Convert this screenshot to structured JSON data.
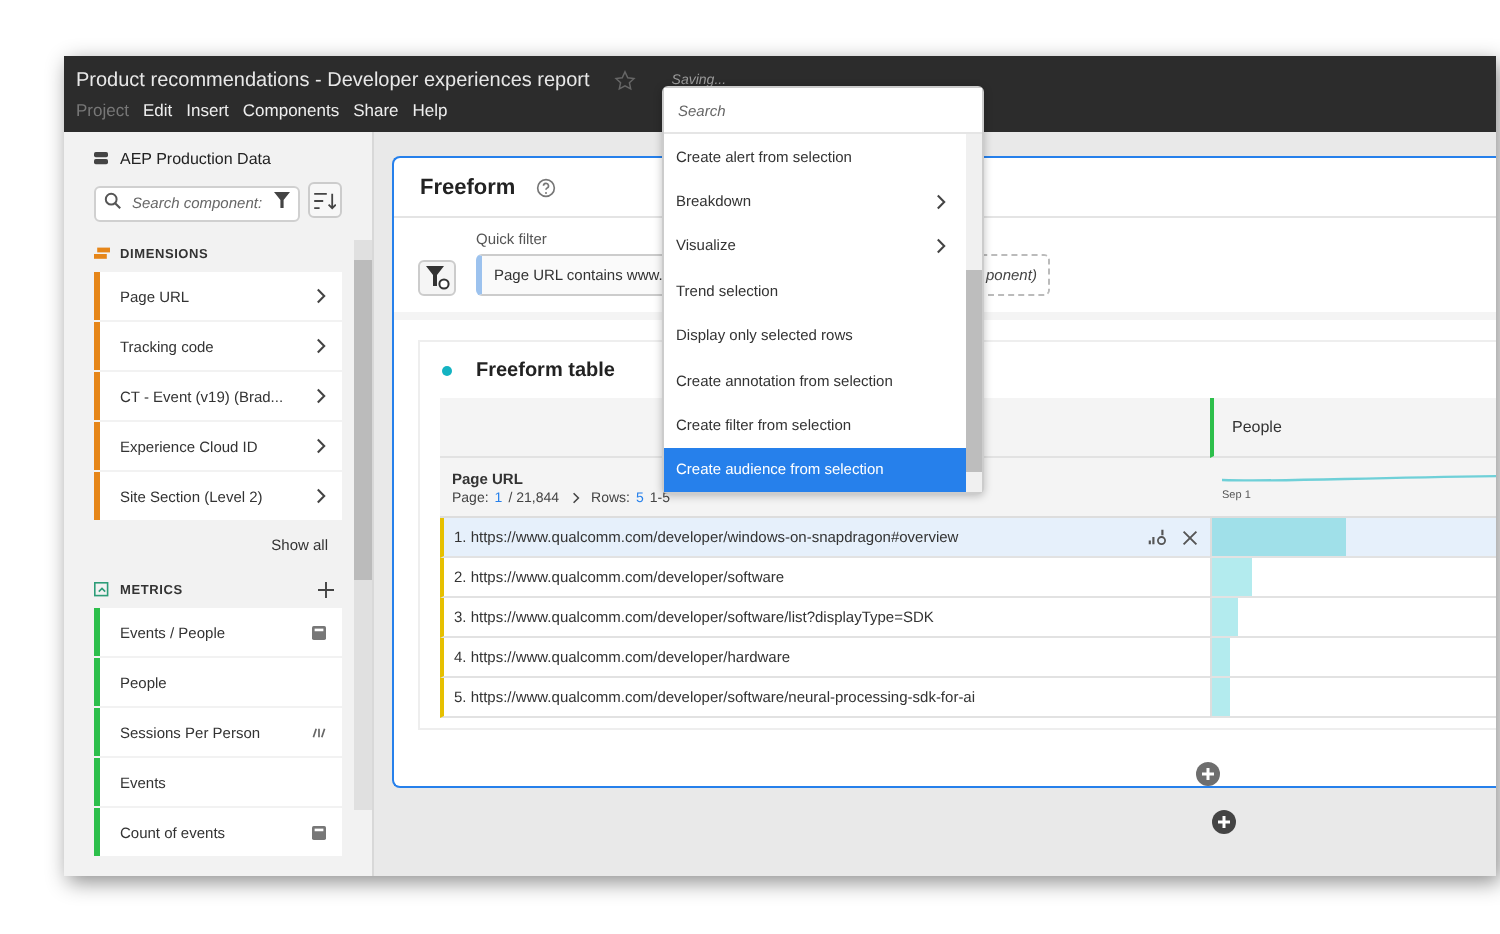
{
  "window": {
    "title": "Product recommendations - Developer experiences report",
    "status": "Saving..."
  },
  "menu_bar": [
    {
      "label": "Project",
      "disabled": true
    },
    {
      "label": "Edit",
      "disabled": false
    },
    {
      "label": "Insert",
      "disabled": false
    },
    {
      "label": "Components",
      "disabled": false
    },
    {
      "label": "Share",
      "disabled": false
    },
    {
      "label": "Help",
      "disabled": false
    }
  ],
  "sidebar": {
    "data_view": "AEP Production Data",
    "search": {
      "placeholder": "Search component:"
    },
    "dimensions": {
      "title": "DIMENSIONS",
      "items": [
        "Page URL",
        "Tracking code",
        "CT - Event (v19) (Brad...",
        "Experience Cloud ID",
        "Site Section (Level 2)"
      ],
      "show_all": "Show all"
    },
    "metrics": {
      "title": "METRICS",
      "items": [
        {
          "label": "Events / People",
          "kind": "calculated"
        },
        {
          "label": "People",
          "kind": "plain"
        },
        {
          "label": "Sessions Per Person",
          "kind": "shared"
        },
        {
          "label": "Events",
          "kind": "plain"
        },
        {
          "label": "Count of events",
          "kind": "calculated"
        }
      ]
    }
  },
  "panel": {
    "title": "Freeform",
    "quick_filter": {
      "label": "Quick filter",
      "value": "Page URL contains www.",
      "value_tail": "ponent)"
    },
    "table": {
      "title": "Freeform table",
      "dimension": "Page URL",
      "pagination": {
        "page_label": "Page:",
        "page": "1",
        "page_total": "/ 21,844",
        "rows_label": "Rows:",
        "rows": "5",
        "range": "1-5"
      },
      "columns": [
        {
          "label": "People",
          "axis_label": "Sep 1"
        }
      ],
      "rows": [
        {
          "label": "1.  https://www.qualcomm.com/developer/windows-on-snapdragon#overview",
          "selected": true,
          "level": 0.46
        },
        {
          "label": "2.  https://www.qualcomm.com/developer/software",
          "selected": false,
          "level": 0.14
        },
        {
          "label": "3.  https://www.qualcomm.com/developer/software/list?displayType=SDK",
          "selected": false,
          "level": 0.09
        },
        {
          "label": "4.  https://www.qualcomm.com/developer/hardware",
          "selected": false,
          "level": 0.06
        },
        {
          "label": "5.  https://www.qualcomm.com/developer/software/neural-processing-sdk-for-ai",
          "selected": false,
          "level": 0.06
        }
      ]
    }
  },
  "context_menu": {
    "search": {
      "placeholder": "Search"
    },
    "items": [
      {
        "label": "Create alert from selection",
        "submenu": false,
        "selected": false
      },
      {
        "label": "Breakdown",
        "submenu": true,
        "selected": false
      },
      {
        "label": "Visualize",
        "submenu": true,
        "selected": false
      },
      {
        "label": "Trend selection",
        "submenu": false,
        "selected": false
      },
      {
        "label": "Display only selected rows",
        "submenu": false,
        "selected": false
      },
      {
        "label": "Create annotation from selection",
        "submenu": false,
        "selected": false
      },
      {
        "label": "Create filter from selection",
        "submenu": false,
        "selected": false
      },
      {
        "label": "Create audience from selection",
        "submenu": false,
        "selected": true
      }
    ]
  }
}
